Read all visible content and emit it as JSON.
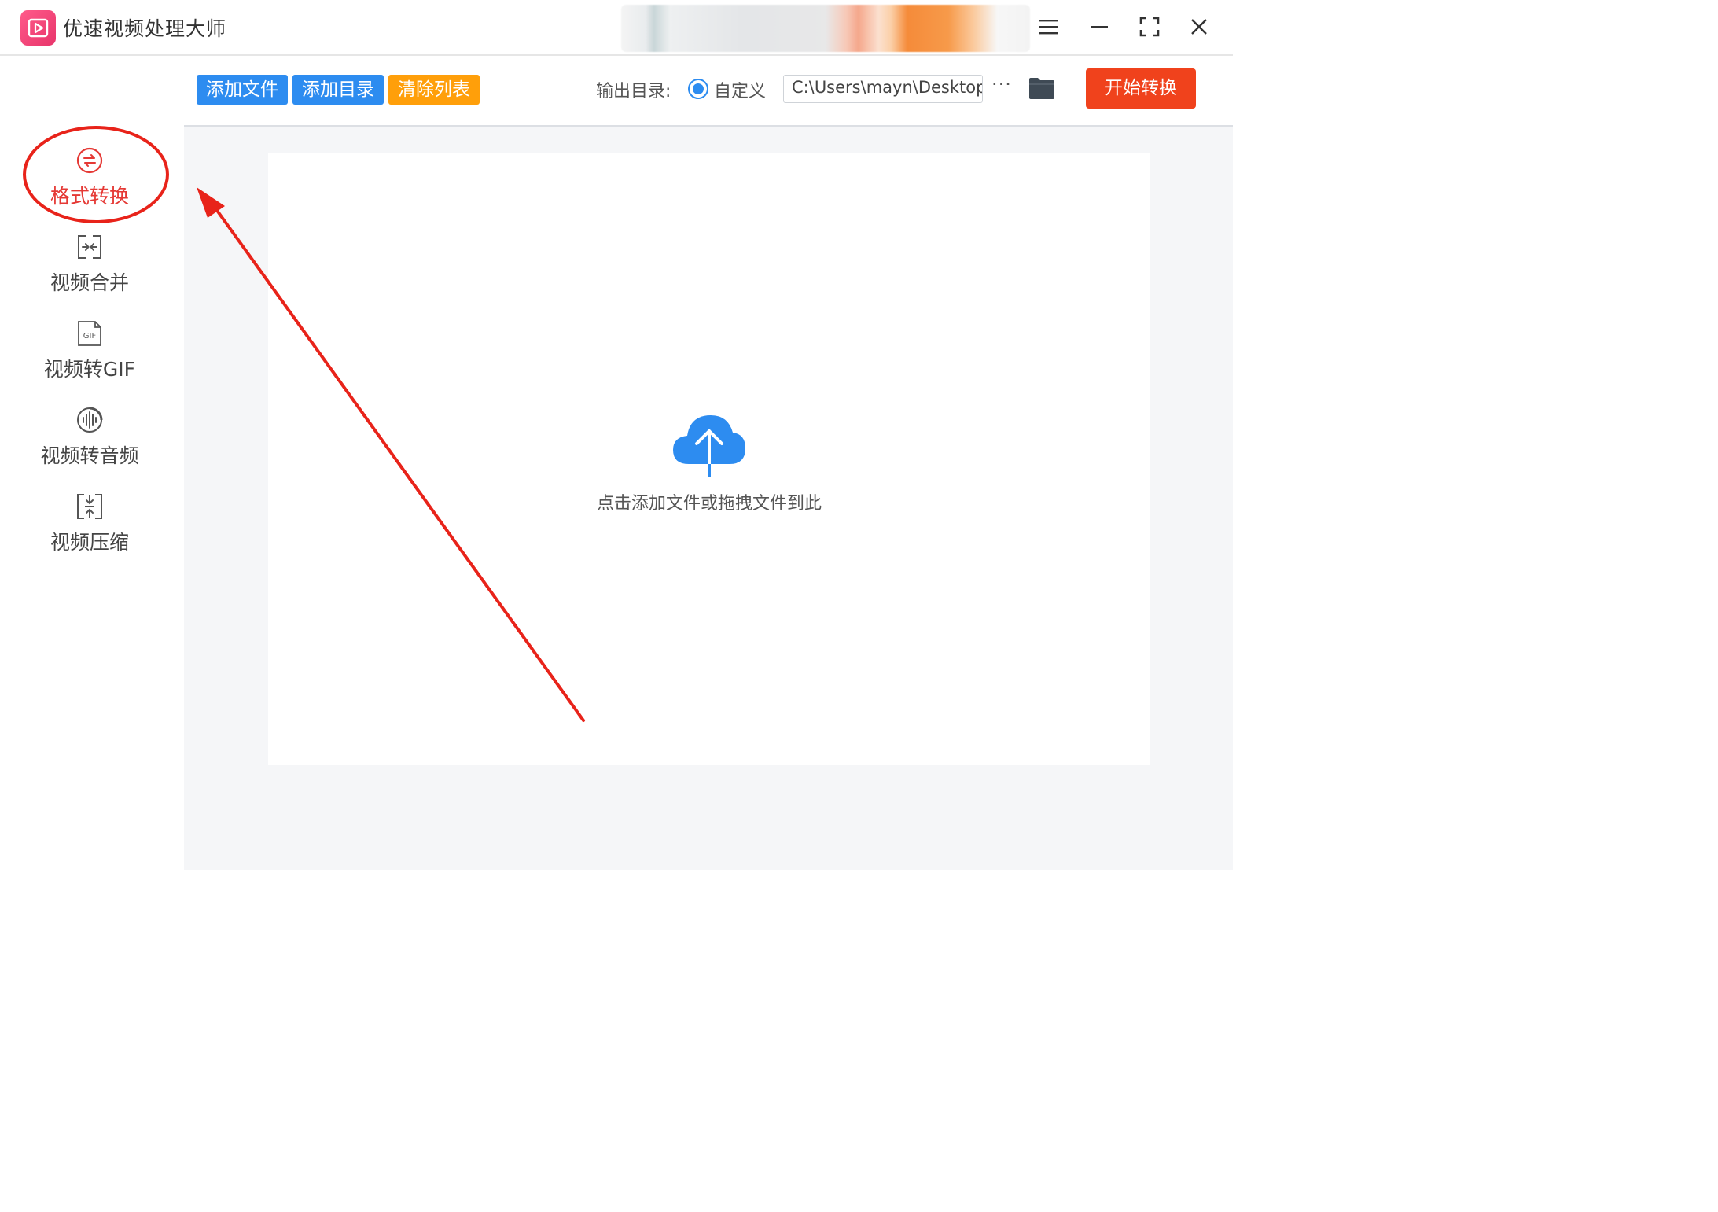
{
  "app": {
    "title": "优速视频处理大师"
  },
  "window_controls": [
    "menu-icon",
    "minimize-icon",
    "maximize-icon",
    "close-icon"
  ],
  "sidebar": {
    "items": [
      {
        "label": "格式转换",
        "icon": "format-convert-icon",
        "active": true
      },
      {
        "label": "视频合并",
        "icon": "merge-icon",
        "active": false
      },
      {
        "label": "视频转GIF",
        "icon": "gif-file-icon",
        "active": false
      },
      {
        "label": "视频转音频",
        "icon": "audio-wave-icon",
        "active": false
      },
      {
        "label": "视频压缩",
        "icon": "compress-icon",
        "active": false
      }
    ]
  },
  "toolbar": {
    "add_file": "添加文件",
    "add_folder": "添加目录",
    "clear_list": "清除列表",
    "output_label": "输出目录:",
    "custom_option": "自定义",
    "output_path": "C:\\Users\\mayn\\Desktop",
    "more": "···",
    "start": "开始转换"
  },
  "dropzone": {
    "hint": "点击添加文件或拖拽文件到此"
  },
  "colors": {
    "primary_blue": "#2d8cf0",
    "orange": "#ff9f0a",
    "start_red": "#f0421c",
    "active_red": "#e53935",
    "annotation_red": "#e8231a"
  }
}
